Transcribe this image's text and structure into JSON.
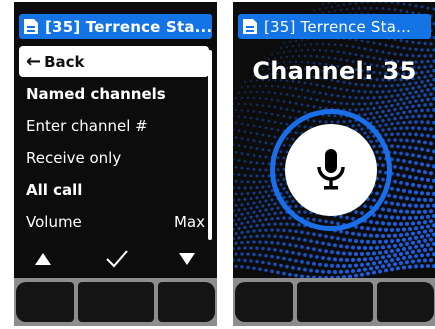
{
  "left_screen": {
    "title_bar": {
      "icon": "document-icon",
      "title": "[35] Terrence Sta..."
    },
    "menu": {
      "items": [
        {
          "id": "back",
          "label": "Back",
          "icon": "back-arrow-icon",
          "selected": true
        },
        {
          "id": "named-channels",
          "label": "Named channels"
        },
        {
          "id": "enter-channel",
          "label": "Enter channel #"
        },
        {
          "id": "receive-only",
          "label": "Receive only"
        },
        {
          "id": "all-call",
          "label": "All call"
        },
        {
          "id": "volume",
          "label": "Volume",
          "value": "Max"
        }
      ]
    },
    "softkeys": [
      {
        "id": "up",
        "icon": "up-triangle-icon"
      },
      {
        "id": "ok",
        "icon": "checkmark-icon"
      },
      {
        "id": "down",
        "icon": "down-triangle-icon"
      }
    ]
  },
  "right_screen": {
    "title_bar": {
      "icon": "document-icon",
      "title": "[35] Terrence Sta..."
    },
    "channel_label": "Channel: 35",
    "ptt_icon": "microphone-icon"
  },
  "colors": {
    "accent_blue": "#1474e6",
    "ring_blue": "#1a6ee8",
    "screen_bg": "#0c0c0c",
    "hardware_gray": "#8d8d8d"
  }
}
